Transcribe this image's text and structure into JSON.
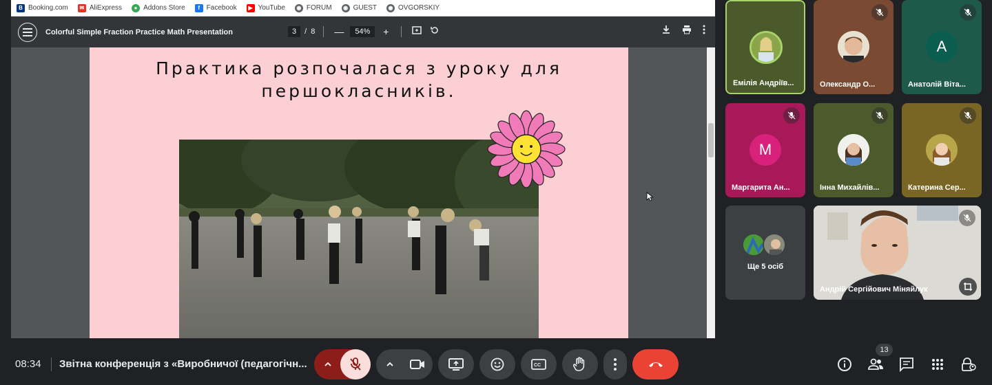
{
  "bookmarks": [
    {
      "label": "Booking.com",
      "icon": "booking-icon",
      "color": "#003580",
      "glyph": "B"
    },
    {
      "label": "AliExpress",
      "icon": "aliexpress-icon",
      "color": "#e43225",
      "glyph": "✉"
    },
    {
      "label": "Addons Store",
      "icon": "addons-store-icon",
      "color": "#34a853",
      "glyph": "●"
    },
    {
      "label": "Facebook",
      "icon": "facebook-icon",
      "color": "#1877f2",
      "glyph": "f"
    },
    {
      "label": "YouTube",
      "icon": "youtube-icon",
      "color": "#ff0000",
      "glyph": "▶"
    },
    {
      "label": "FORUM",
      "icon": "globe-icon",
      "color": "#5f6368",
      "glyph": "◉"
    },
    {
      "label": "GUEST",
      "icon": "globe-icon",
      "color": "#5f6368",
      "glyph": "◉"
    },
    {
      "label": "OVGORSKIY",
      "icon": "globe-icon",
      "color": "#5f6368",
      "glyph": "◉"
    }
  ],
  "pdf": {
    "title": "Colorful Simple Fraction Practice Math Presentation",
    "current_page": "3",
    "page_sep": "/",
    "total_pages": "8",
    "zoom": "54%",
    "slide_title_line1": "Практика розпочалася з уроку для",
    "slide_title_line2": "першокласників."
  },
  "participants": [
    {
      "name": "Емілія Андріїв...",
      "avatar_type": "photo",
      "bg": "#4a5a2a",
      "highlight": true,
      "muted": false
    },
    {
      "name": "Олександр О...",
      "avatar_type": "photo",
      "bg": "#7a4a32",
      "highlight": false,
      "muted": true
    },
    {
      "name": "Анатолій Віта...",
      "avatar_type": "letter",
      "letter": "A",
      "bg": "#1e5a4a",
      "avatar_bg": "#0b5d4f",
      "highlight": false,
      "muted": true
    },
    {
      "name": "Маргарита Ан...",
      "avatar_type": "letter",
      "letter": "M",
      "bg": "#a8195a",
      "avatar_bg": "#d8217a",
      "highlight": false,
      "muted": true
    },
    {
      "name": "Інна Михайлів...",
      "avatar_type": "photo",
      "bg": "#4d5a2c",
      "highlight": false,
      "muted": true
    },
    {
      "name": "Катерина Сер...",
      "avatar_type": "photo",
      "bg": "#7a6624",
      "highlight": false,
      "muted": true
    }
  ],
  "more_people": {
    "label": "Ще 5 осіб"
  },
  "self_view": {
    "name": "Андрій Сергійович Міняйлук"
  },
  "bottom": {
    "time": "08:34",
    "meeting_title": "Звітна конференція з «Виробничої (педагогічн...",
    "participant_count": "13"
  },
  "colors": {
    "end_call": "#ea4335",
    "mic_off_bg": "#f9dedc",
    "mic_group_bg": "#8c1d18",
    "highlight_border": "#a8d26a"
  }
}
